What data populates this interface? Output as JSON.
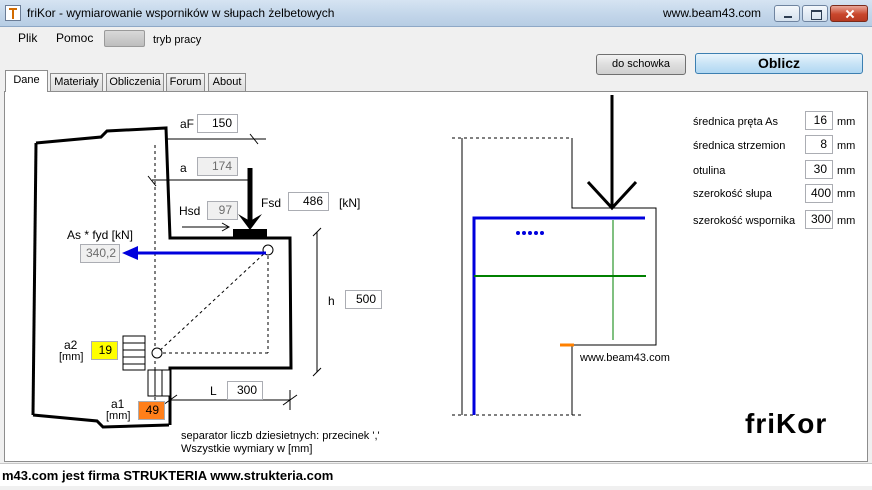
{
  "window": {
    "title": "friKor - wymiarowanie wsporników w słupach żelbetowych",
    "url": "www.beam43.com"
  },
  "menu": {
    "file": "Plik",
    "help": "Pomoc"
  },
  "mode_label": "tryb pracy",
  "toolbar": {
    "clipboard": "do schowka",
    "calculate": "Oblicz"
  },
  "tabs": [
    "Dane",
    "Materiały",
    "Obliczenia",
    "Forum",
    "About"
  ],
  "left": {
    "aF": {
      "label": "aF",
      "value": "150"
    },
    "a": {
      "label": "a",
      "value": "174"
    },
    "Hsd": {
      "label": "Hsd",
      "value": "97"
    },
    "Fsd": {
      "label": "Fsd",
      "value": "486",
      "unit": "[kN]"
    },
    "As": {
      "label": "As * fyd [kN]",
      "value": "340,2"
    },
    "h": {
      "label": "h",
      "value": "500"
    },
    "a2": {
      "label": "a2",
      "unit": "[mm]",
      "value": "19"
    },
    "L": {
      "label": "L",
      "value": "300"
    },
    "a1": {
      "label": "a1",
      "unit": "[mm]",
      "value": "49"
    },
    "note1": "separator liczb dziesietnych: przecinek ','",
    "note2": "Wszystkie wymiary w [mm]"
  },
  "right": {
    "params": [
      {
        "label": "średnica pręta As",
        "value": "16",
        "unit": "mm"
      },
      {
        "label": "średnica strzemion",
        "value": "8",
        "unit": "mm"
      },
      {
        "label": "otulina",
        "value": "30",
        "unit": "mm"
      },
      {
        "label": "szerokość słupa",
        "value": "400",
        "unit": "mm"
      },
      {
        "label": "szerokość wspornika",
        "value": "300",
        "unit": "mm"
      }
    ],
    "watermark": "www.beam43.com"
  },
  "brand": "friKor",
  "status": "m43.com jest firma  STRUKTERIA www.strukteria.com",
  "colors": {
    "yellow": "#ffff00",
    "orange": "#ff7f1a",
    "rebar": "#0000dd",
    "stirrup": "#008000",
    "accent": "#3c7fb1"
  }
}
